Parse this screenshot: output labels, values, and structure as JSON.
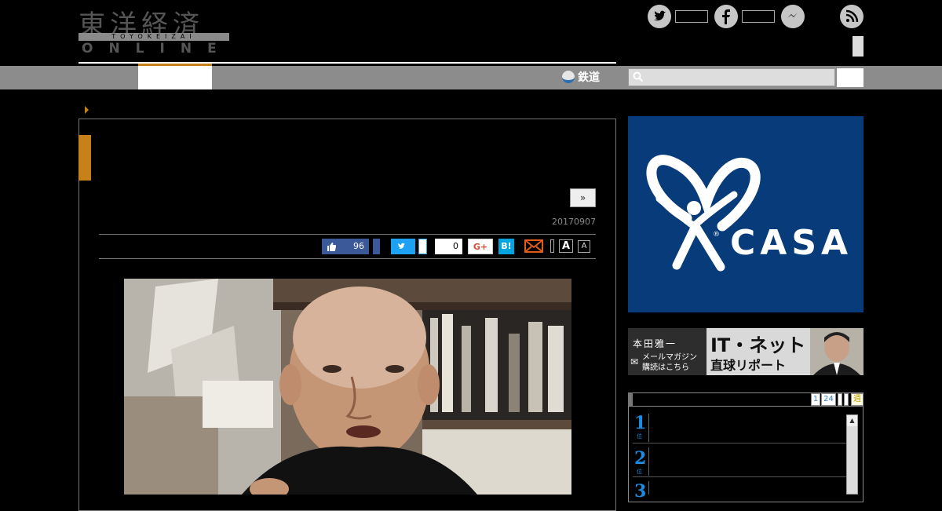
{
  "header": {
    "logo_jp": "東洋経済",
    "logo_sub": "TOYOKEIZAI",
    "logo_en": "ONLINE",
    "social": [
      {
        "name": "twitter",
        "icon": "twitter-icon"
      },
      {
        "name": "facebook",
        "icon": "facebook-icon"
      },
      {
        "name": "messenger",
        "icon": "messenger-icon"
      },
      {
        "name": "rss",
        "icon": "rss-icon"
      }
    ]
  },
  "nav": {
    "rail_label": "鉄道",
    "accent_color": "#c6811b"
  },
  "article": {
    "next_label": "»",
    "date": "20170907",
    "share": {
      "like_count": "96",
      "share_count": "0",
      "gplus_label": "G+",
      "hatena_label": "B!",
      "font_large": "A",
      "font_small": "A"
    }
  },
  "sidebar": {
    "ad_casa_text": "CASA",
    "ad_casa_reg": "®",
    "banner": {
      "author": "本田雅一",
      "title": "IT・ネット",
      "subtitle": "直球リポート",
      "mail_line1": "メールマガジン",
      "mail_line2": "購読はこちら"
    },
    "ranking": {
      "tabs": [
        "1",
        "24",
        "",
        "",
        "週"
      ],
      "items": [
        {
          "rank": "1",
          "sub": "位"
        },
        {
          "rank": "2",
          "sub": "位"
        },
        {
          "rank": "3",
          "sub": "位"
        }
      ]
    }
  }
}
